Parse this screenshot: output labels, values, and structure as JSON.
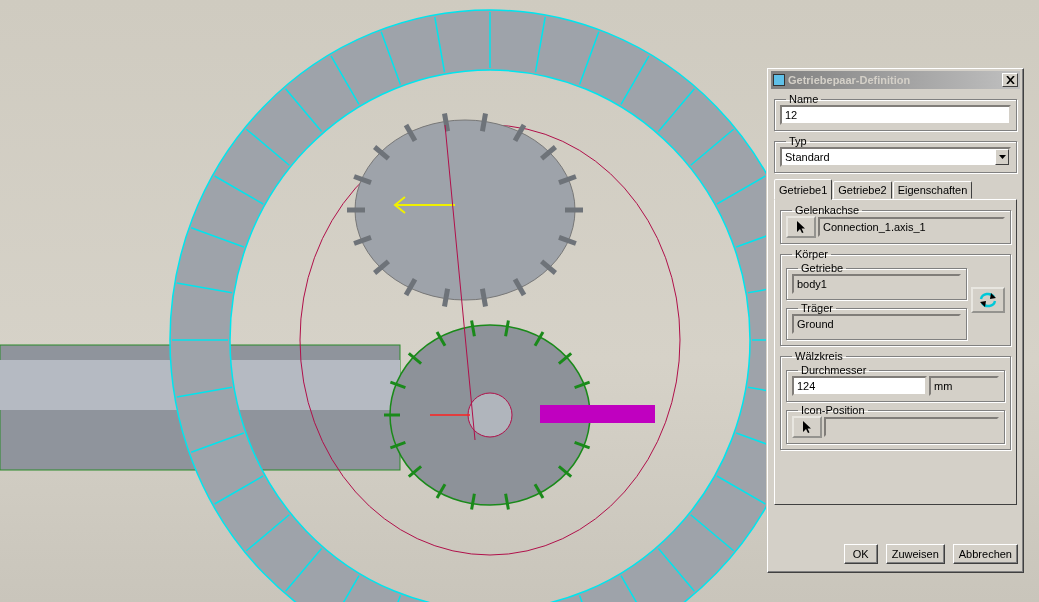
{
  "window": {
    "title": "Getriebepaar-Definition"
  },
  "name": {
    "label": "Name",
    "value": "12"
  },
  "type": {
    "label": "Typ",
    "value": "Standard"
  },
  "tabs": [
    {
      "label": "Getriebe1",
      "selected": true
    },
    {
      "label": "Getriebe2",
      "selected": false
    },
    {
      "label": "Eigenschaften",
      "selected": false
    }
  ],
  "joint_axis": {
    "label": "Gelenkachse",
    "value": "Connection_1.axis_1"
  },
  "body": {
    "label": "Körper",
    "gear": {
      "label": "Getriebe",
      "value": "body1"
    },
    "carrier": {
      "label": "Träger",
      "value": "Ground"
    }
  },
  "pitch_circle": {
    "label": "Wälzkreis",
    "diameter": {
      "label": "Durchmesser",
      "value": "124",
      "unit": "mm"
    },
    "icon_position": {
      "label": "Icon-Position"
    }
  },
  "buttons": [
    "OK",
    "Zuweisen",
    "Abbrechen"
  ]
}
